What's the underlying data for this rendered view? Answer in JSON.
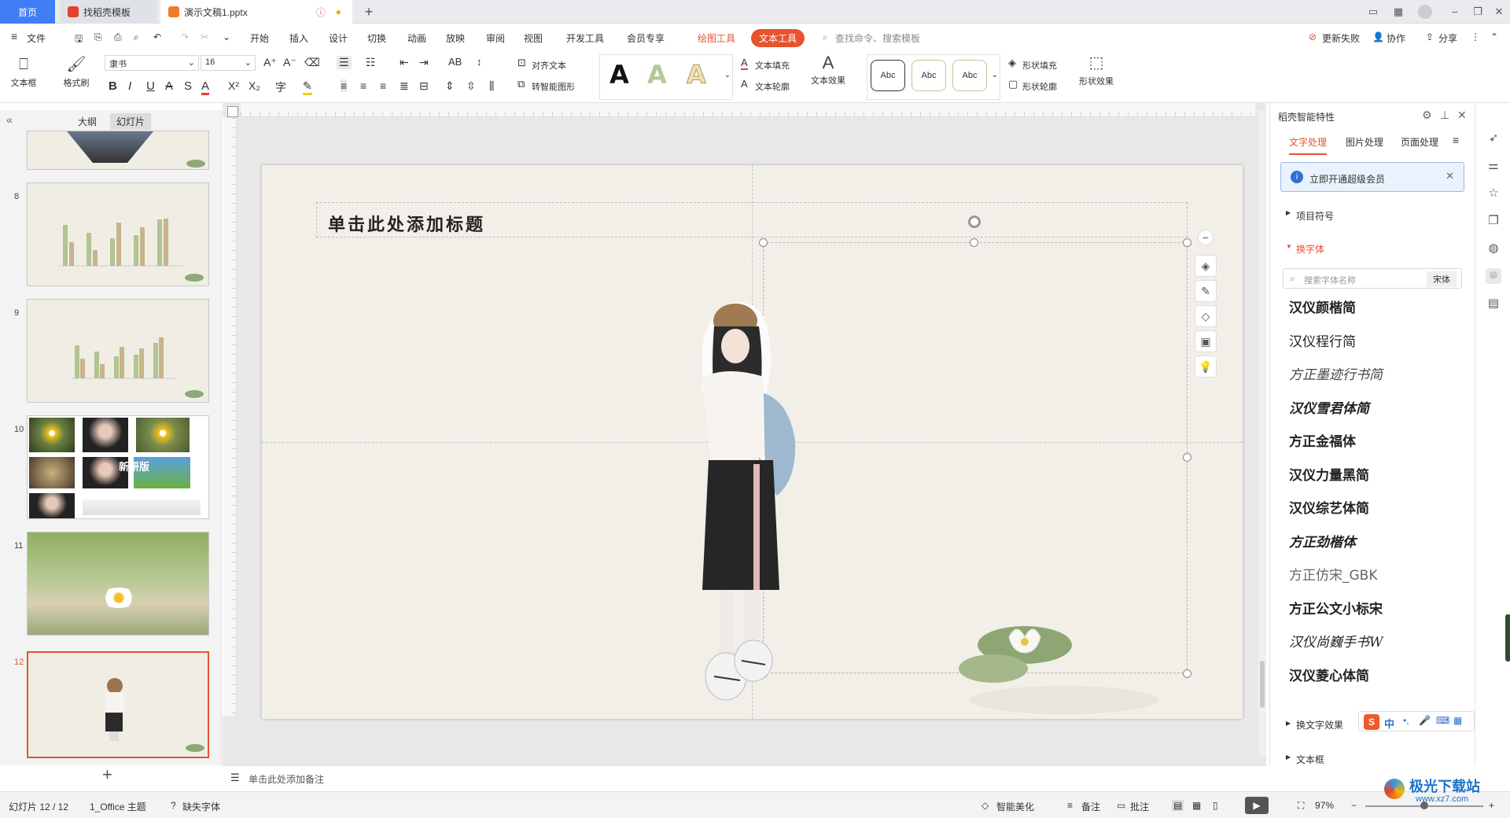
{
  "tabs": {
    "home": "首页",
    "tab1": "找稻壳模板",
    "tab2": "演示文稿1.pptx"
  },
  "menu": {
    "file": "文件",
    "items": [
      "开始",
      "插入",
      "设计",
      "切换",
      "动画",
      "放映",
      "审阅",
      "视图",
      "开发工具",
      "会员专享"
    ],
    "drawing_tools": "绘图工具",
    "text_tools": "文本工具",
    "search_placeholder": "查找命令、搜索模板",
    "update_failed": "更新失败",
    "collaborate": "协作",
    "share": "分享"
  },
  "ribbon": {
    "textbox": "文本框",
    "format_painter": "格式刷",
    "font_name": "隶书",
    "font_size": "16",
    "align_text": "对齐文本",
    "smart_shape": "转智能图形",
    "text_fill": "文本填充",
    "text_outline": "文本轮廓",
    "text_effect": "文本效果",
    "abc": "Abc",
    "shape_fill": "形状填充",
    "shape_outline": "形状轮廓",
    "shape_effect": "形状效果"
  },
  "leftpanel": {
    "outline_tab": "大纲",
    "slides_tab": "幻灯片",
    "slide_numbers": [
      "8",
      "9",
      "10",
      "11",
      "12"
    ],
    "thumb10_text": "新研版"
  },
  "slide": {
    "title_placeholder": "单击此处添加标题"
  },
  "notes": {
    "placeholder": "单击此处添加备注"
  },
  "rightpanel": {
    "header": "稻壳智能特性",
    "tabs": [
      "文字处理",
      "图片处理",
      "页面处理"
    ],
    "banner": "立即开通超级会员",
    "bullets": "项目符号",
    "change_font": "换字体",
    "font_search_placeholder": "搜索字体名称",
    "font_search_current": "宋体",
    "fonts": [
      "汉仪颜楷简",
      "汉仪程行简",
      "方正墨迹行书简",
      "汉仪雪君体简",
      "方正金福体",
      "汉仪力量黑简",
      "汉仪综艺体简",
      "方正劲楷体",
      "方正仿宋_GBK",
      "方正公文小标宋",
      "汉仪尚巍手书W",
      "汉仪菱心体简"
    ],
    "text_effect_section": "换文字效果",
    "textbox_section": "文本框",
    "ime": "中"
  },
  "statusbar": {
    "slide_counter": "幻灯片 12 / 12",
    "theme": "1_Office 主题",
    "missing_font": "缺失字体",
    "smart_beautify": "智能美化",
    "notes": "备注",
    "comments": "批注",
    "zoom": "97%"
  },
  "watermark": {
    "name": "极光下载站",
    "url": "www.xz7.com"
  },
  "colors": {
    "accent": "#e5532f",
    "home_tab": "#3f7ef5",
    "selected_thumb": "#e5532f",
    "slide_bg": "#f1efe8"
  }
}
